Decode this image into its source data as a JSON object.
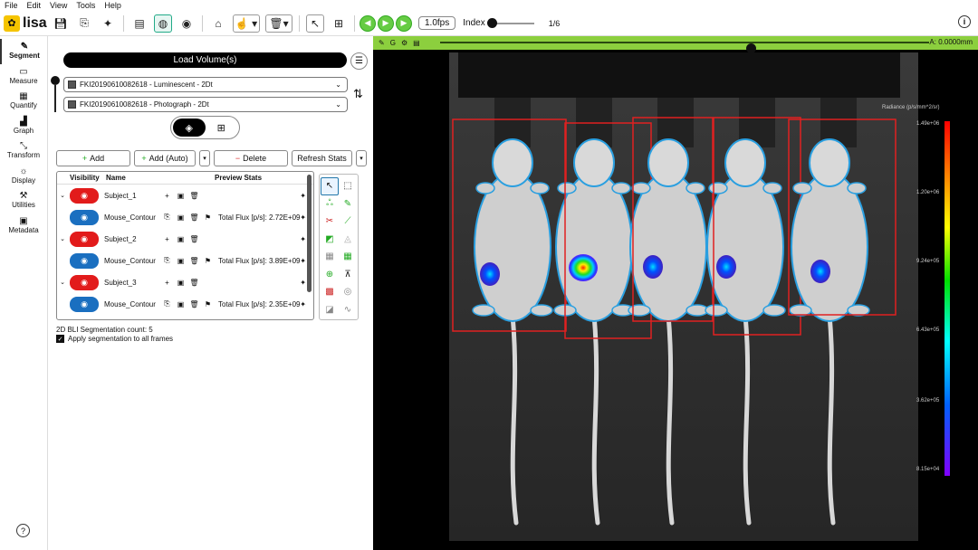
{
  "menu": [
    "File",
    "Edit",
    "View",
    "Tools",
    "Help"
  ],
  "app": {
    "name": "lisa"
  },
  "toolbar": {
    "fps": "1.0fps",
    "index_label": "Index",
    "index_value": "1/6"
  },
  "nav": [
    {
      "label": "Segment",
      "icon": "pencil-icon",
      "glyph": "✎",
      "active": true
    },
    {
      "label": "Measure",
      "icon": "ruler-icon",
      "glyph": "▭",
      "active": false
    },
    {
      "label": "Quantify",
      "icon": "table-icon",
      "glyph": "▦",
      "active": false
    },
    {
      "label": "Graph",
      "icon": "chart-icon",
      "glyph": "▟",
      "active": false
    },
    {
      "label": "Transform",
      "icon": "transform-icon",
      "glyph": "⤡",
      "active": false
    },
    {
      "label": "Display",
      "icon": "sun-icon",
      "glyph": "☼",
      "active": false
    },
    {
      "label": "Utilities",
      "icon": "tools-icon",
      "glyph": "⚒",
      "active": false
    },
    {
      "label": "Metadata",
      "icon": "metadata-icon",
      "glyph": "▣",
      "active": false
    }
  ],
  "panel": {
    "load_label": "Load Volume(s)",
    "volume1": "FKI20190610082618 - Luminescent - 2Dt",
    "volume2": "FKI20190610082618 - Photograph - 2Dt",
    "add_label": "Add",
    "add_auto_label": "Add (Auto)",
    "delete_label": "Delete",
    "refresh_label": "Refresh Stats",
    "col_visibility": "Visibility",
    "col_name": "Name",
    "col_preview": "Preview Stats",
    "rows": [
      {
        "type": "subject",
        "name": "Subject_1"
      },
      {
        "type": "contour",
        "name": "Mouse_Contour",
        "stat": "Total Flux [p/s]: 2.72E+09"
      },
      {
        "type": "subject",
        "name": "Subject_2"
      },
      {
        "type": "contour",
        "name": "Mouse_Contour",
        "stat": "Total Flux [p/s]: 3.89E+09"
      },
      {
        "type": "subject",
        "name": "Subject_3"
      },
      {
        "type": "contour",
        "name": "Mouse_Contour",
        "stat": "Total Flux [p/s]: 2.35E+09"
      }
    ],
    "seg_count": "2D BLI Segmentation count: 5",
    "apply_label": "Apply segmentation to all frames"
  },
  "viewer": {
    "readout": "A: 0.0000mm",
    "colorbar_title": "Radiance (p/s/mm^2/sr)",
    "colorbar_ticks": [
      "1.49e+06",
      "1.20e+06",
      "9.24e+05",
      "6.43e+05",
      "3.62e+05",
      "8.15e+04"
    ]
  },
  "colors": {
    "accent_green": "#8ccf3e",
    "visibility_red": "#e21b1b",
    "visibility_blue": "#1a6fc0",
    "roi": "#e02020",
    "contour": "#2a9fe0"
  }
}
